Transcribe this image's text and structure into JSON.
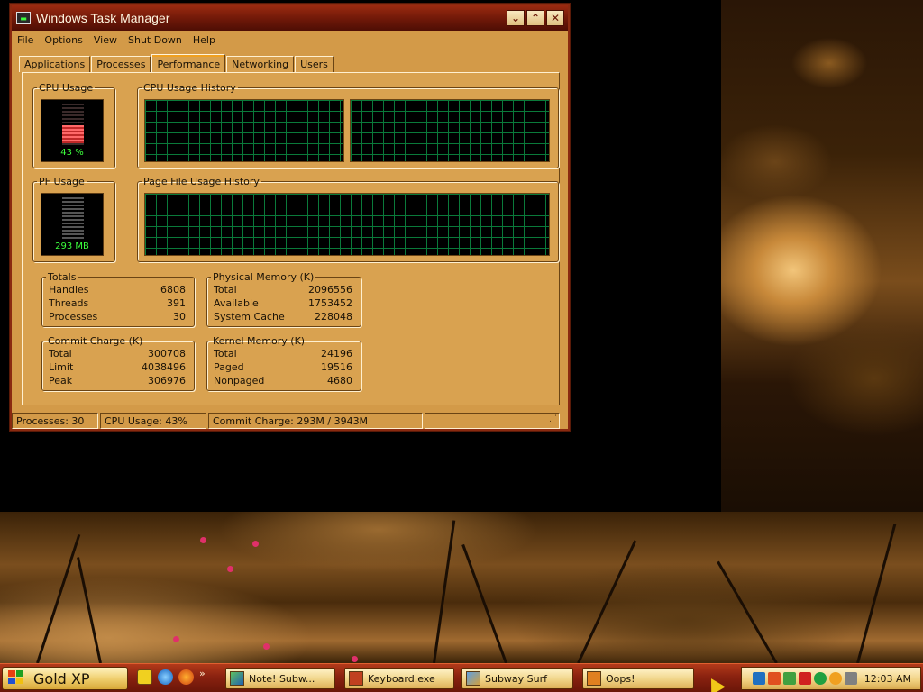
{
  "window": {
    "title": "Windows Task Manager",
    "buttons": {
      "minimize": "⌄",
      "restore": "⌃",
      "close": "✕"
    }
  },
  "menu": [
    "File",
    "Options",
    "View",
    "Shut Down",
    "Help"
  ],
  "tabs": [
    "Applications",
    "Processes",
    "Performance",
    "Networking",
    "Users"
  ],
  "active_tab": "Performance",
  "cpu": {
    "label": "CPU Usage",
    "value": "43 %",
    "level_percent": 43,
    "history_label": "CPU Usage History"
  },
  "pf": {
    "label": "PF Usage",
    "value": "293 MB",
    "history_label": "Page File Usage History"
  },
  "totals": {
    "label": "Totals",
    "rows": [
      {
        "name": "Handles",
        "value": "6808"
      },
      {
        "name": "Threads",
        "value": "391"
      },
      {
        "name": "Processes",
        "value": "30"
      }
    ]
  },
  "physical": {
    "label": "Physical Memory (K)",
    "rows": [
      {
        "name": "Total",
        "value": "2096556"
      },
      {
        "name": "Available",
        "value": "1753452"
      },
      {
        "name": "System Cache",
        "value": "228048"
      }
    ]
  },
  "commit": {
    "label": "Commit Charge (K)",
    "rows": [
      {
        "name": "Total",
        "value": "300708"
      },
      {
        "name": "Limit",
        "value": "4038496"
      },
      {
        "name": "Peak",
        "value": "306976"
      }
    ]
  },
  "kernel": {
    "label": "Kernel Memory (K)",
    "rows": [
      {
        "name": "Total",
        "value": "24196"
      },
      {
        "name": "Paged",
        "value": "19516"
      },
      {
        "name": "Nonpaged",
        "value": "4680"
      }
    ]
  },
  "status": {
    "processes": "Processes: 30",
    "cpu": "CPU Usage: 43%",
    "commit": "Commit Charge: 293M / 3943M"
  },
  "taskbar": {
    "start_label": "Gold XP",
    "quicklaunch_more": "»",
    "tasks": [
      "Note! Subw...",
      "Keyboard.exe",
      "Subway Surf",
      "Oops!"
    ],
    "clock": "12:03 AM"
  },
  "colors": {
    "meter_green": "#3cff3c",
    "cpu_bar": "#e04040",
    "graph_grid": "#0a7a3a"
  }
}
